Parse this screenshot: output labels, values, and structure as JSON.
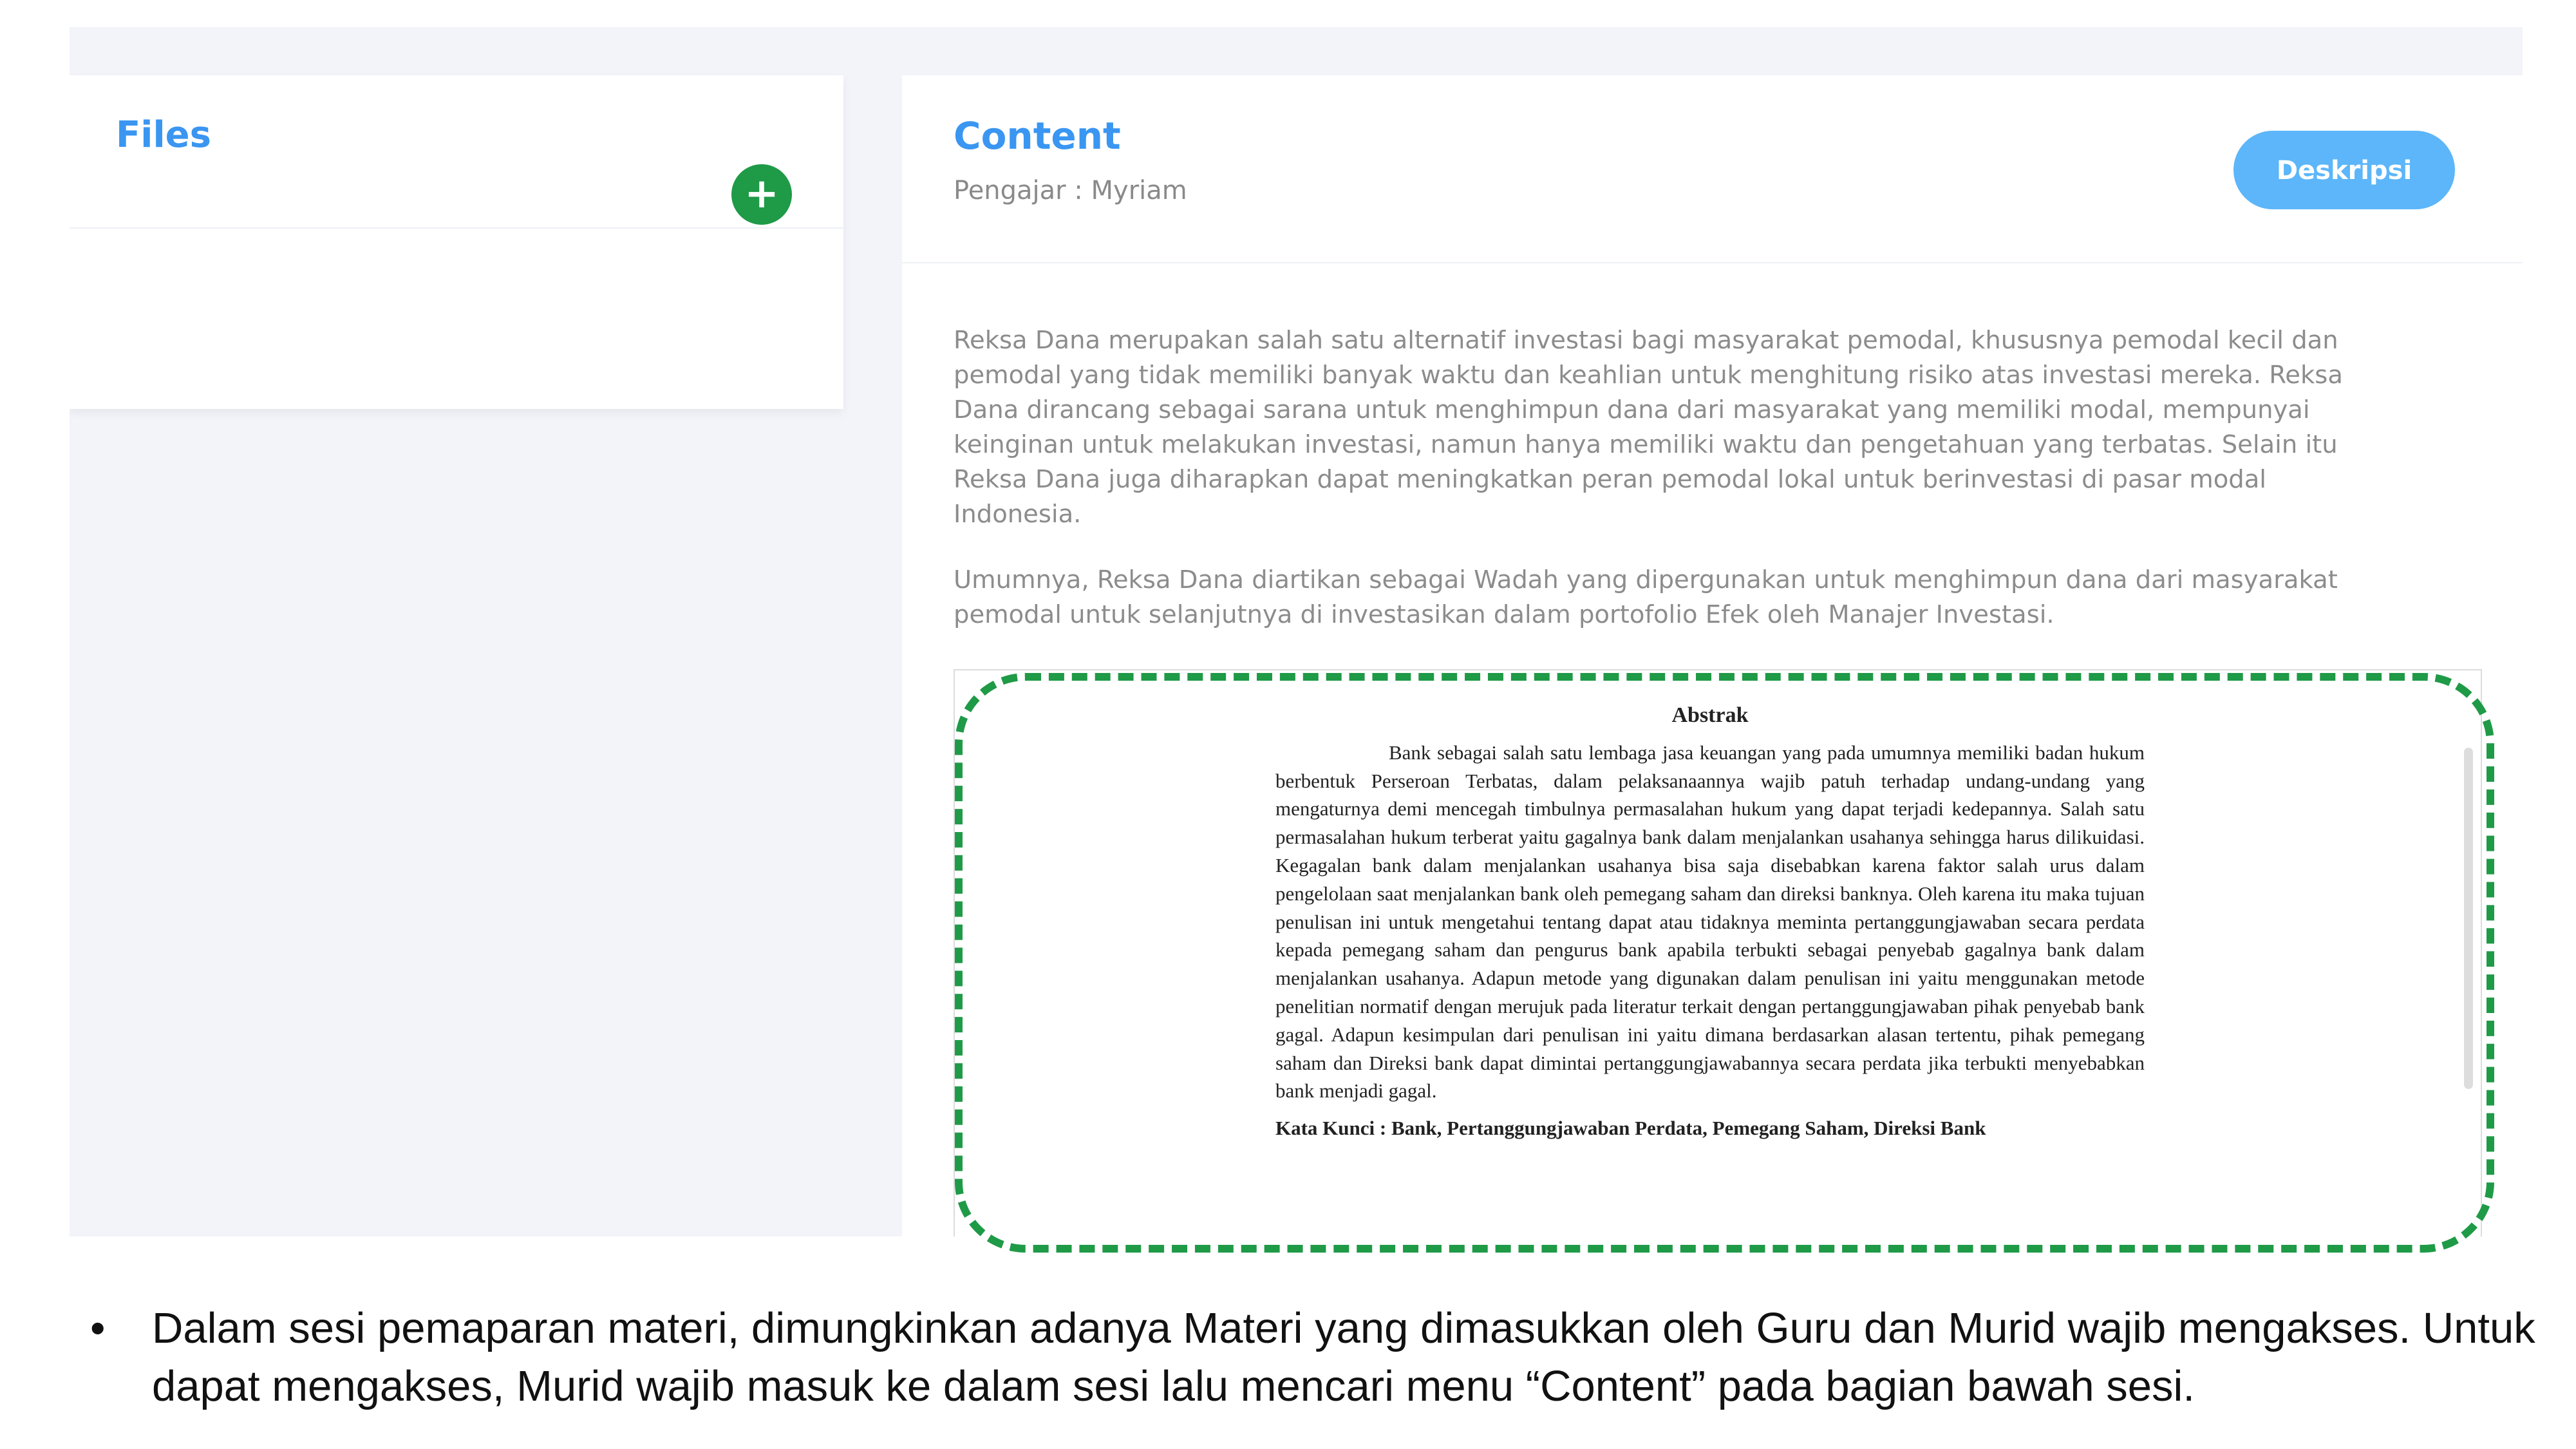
{
  "files_panel": {
    "title": "Files",
    "add_label": "+"
  },
  "content_panel": {
    "title": "Content",
    "teacher": "Pengajar : Myriam",
    "description_button": "Deskripsi",
    "paragraphs": [
      "Reksa Dana merupakan salah satu alternatif investasi bagi masyarakat pemodal, khususnya pemodal kecil dan pemodal yang tidak memiliki banyak waktu dan keahlian untuk menghitung risiko atas investasi mereka. Reksa Dana dirancang sebagai sarana untuk menghimpun dana dari masyarakat yang memiliki modal, mempunyai keinginan untuk melakukan investasi, namun hanya memiliki waktu dan pengetahuan yang terbatas. Selain itu Reksa Dana juga diharapkan dapat meningkatkan peran pemodal lokal untuk berinvestasi di pasar modal Indonesia.",
      "Umumnya, Reksa Dana diartikan sebagai Wadah yang dipergunakan untuk menghimpun dana dari masyarakat pemodal untuk selanjutnya di investasikan dalam portofolio Efek oleh Manajer Investasi."
    ]
  },
  "pdf_viewer": {
    "heading": "Abstrak",
    "abstract": "Bank sebagai salah satu lembaga jasa keuangan yang pada umumnya memiliki badan hukum berbentuk Perseroan Terbatas, dalam pelaksanaannya wajib patuh terhadap undang-undang yang mengaturnya demi mencegah timbulnya permasalahan hukum yang dapat terjadi kedepannya. Salah satu permasalahan hukum terberat yaitu gagalnya bank dalam menjalankan usahanya sehingga harus dilikuidasi. Kegagalan bank dalam menjalankan usahanya bisa saja disebabkan karena faktor salah urus dalam pengelolaan saat menjalankan bank oleh pemegang saham dan direksi banknya. Oleh karena itu maka tujuan penulisan ini untuk mengetahui tentang dapat atau tidaknya meminta pertanggungjawaban secara perdata kepada pemegang saham dan pengurus bank apabila terbukti sebagai penyebab gagalnya bank dalam menjalankan usahanya. Adapun metode yang digunakan dalam penulisan ini yaitu menggunakan metode penelitian normatif dengan merujuk pada literatur terkait dengan pertanggungjawaban pihak penyebab bank gagal. Adapun kesimpulan dari penulisan ini yaitu dimana berdasarkan alasan tertentu, pihak pemegang saham dan Direksi bank dapat dimintai pertanggungjawabannya secara perdata jika terbukti menyebabkan bank menjadi gagal.",
    "keywords": "Kata Kunci : Bank, Pertanggungjawaban Perdata, Pemegang Saham, Direksi Bank"
  },
  "annotation": {
    "highlight_color": "#1f9a47",
    "bullet": "•",
    "text": "Dalam sesi pemaparan materi, dimungkinkan adanya Materi yang dimasukkan oleh Guru dan Murid wajib mengakses. Untuk dapat mengakses, Murid wajib masuk ke dalam sesi lalu mencari menu “Content” pada bagian bawah sesi."
  }
}
